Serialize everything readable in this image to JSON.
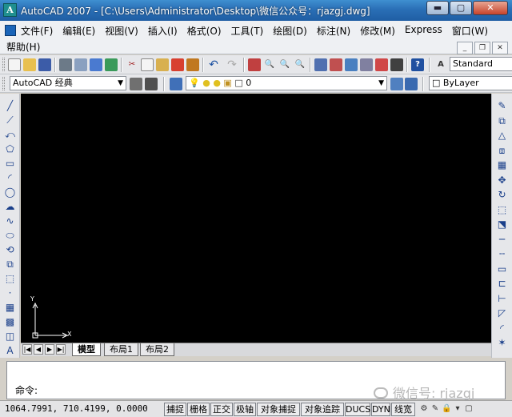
{
  "window": {
    "title": "AutoCAD 2007 - [C:\\Users\\Administrator\\Desktop\\微信公众号：rjazgj.dwg]",
    "app_icon_letter": "A",
    "minimize": "▬",
    "maximize": "▢",
    "close": "✕"
  },
  "menu": {
    "row1": [
      "文件(F)",
      "编辑(E)",
      "视图(V)",
      "插入(I)",
      "格式(O)",
      "工具(T)",
      "绘图(D)",
      "标注(N)",
      "修改(M)",
      "Express",
      "窗口(W)"
    ],
    "row2": "帮助(H)",
    "doc_minimize": "_",
    "doc_restore": "❐",
    "doc_close": "✕"
  },
  "toolbar": {
    "text_style": "Standard",
    "workspace": "AutoCAD 经典",
    "layer": "0",
    "bylayer": "ByLayer",
    "dropdown_arrow": "▼"
  },
  "left_tools": [
    "╱",
    "⟋",
    "⤺",
    "⬠",
    "▭",
    "◜",
    "◯",
    "☁",
    "∿",
    "⬭",
    "⟲",
    "⧉",
    "⬚",
    "·",
    "▦",
    "▩",
    "◫",
    "A"
  ],
  "right_tools": [
    "✎",
    "⧉",
    "△",
    "⧈",
    "▦",
    "✥",
    "↻",
    "⬚",
    "⬔",
    "─",
    "╌",
    "▭",
    "⊏",
    "⊢",
    "◸",
    "◜",
    "✶"
  ],
  "canvas": {
    "ucs_y": "Y",
    "ucs_x": "X"
  },
  "tabs": {
    "nav": [
      "|◀",
      "◀",
      "▶",
      "▶|"
    ],
    "items": [
      "模型",
      "布局1",
      "布局2"
    ],
    "active": "模型"
  },
  "command": {
    "prompt": "命令:",
    "watermark": "微信号: rjazgj"
  },
  "status": {
    "coords": "1064.7991, 710.4199, 0.0000",
    "buttons": [
      "捕捉",
      "栅格",
      "正交",
      "极轴",
      "对象捕捉",
      "对象追踪",
      "DUCS",
      "DYN",
      "线宽"
    ],
    "tray_icons": [
      "⚙",
      "✎",
      "🔒",
      "▾",
      "▢"
    ]
  }
}
